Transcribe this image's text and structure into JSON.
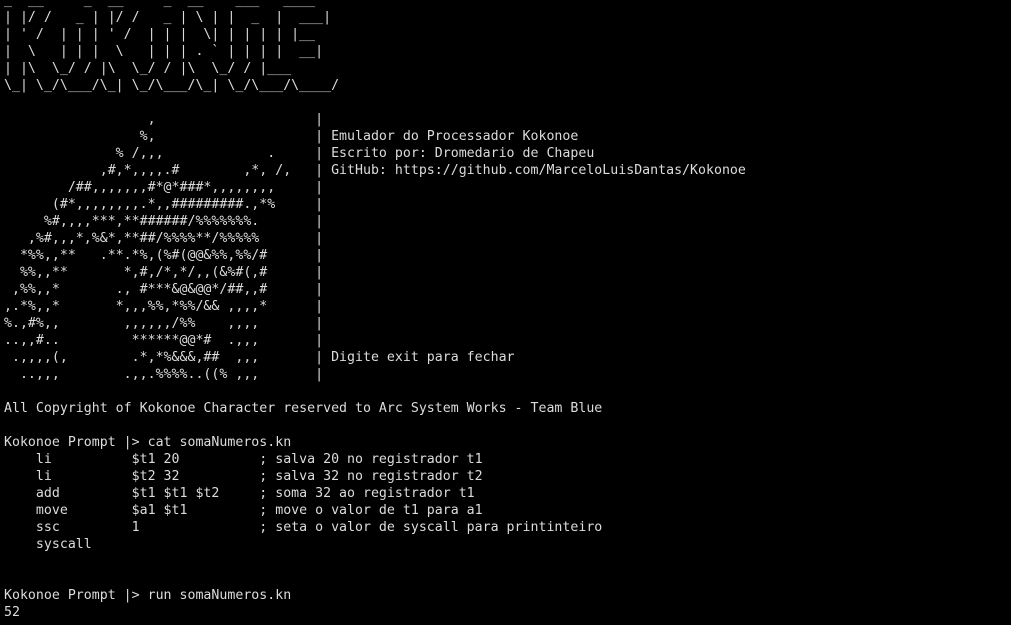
{
  "terminal": {
    "lines": [
      "_  __     _  __     _  __    ___   ____  ",
      "| |/ /   _ | |/ /   _ | \\ | |  _  |  ___|",
      "| ' /  | | | ' /  | | |  \\| | | | | |__  ",
      "|  \\   | | |  \\   | | | . ` | | | |  __| ",
      "| |\\  \\_/ / |\\  \\_/ / |\\  \\_/ / |___ ",
      "\\_| \\_/\\___/\\_| \\_/\\___/\\_| \\_/\\___/\\____/ ",
      "",
      "                  ,                    |",
      "                 %,                    | Emulador do Processador Kokonoe",
      "              % /,,,             .     | Escrito por: Dromedario de Chapeu",
      "            ,#,*,,,,.#        ,*, /,   | GitHub: https://github.com/MarceloLuisDantas/Kokonoe",
      "        /##,,,,,,,#*@*###*,,,,,,,,     |",
      "      (#*,,,,,,,,.*,,#########.,*%     |",
      "     %#,,,,***,**######/%%%%%%%.       |",
      "   ,%#,,,*,%&*,**##/%%%%**/%%%%%       |",
      "  *%%,,**   .**.*%,(%#(@@&%%,%%/#      |",
      "  %%,,**       *,#,/*,*/,,(&%#(,#      |",
      " ,%%,,*       ., #***&@&@@*/##,,#      |",
      ",.*%,,*       *,,,%%,*%%/&& ,,,,*      |",
      "%.,#%,,        ,,,,,,/%%    ,,,,       |",
      "..,,#..         ******@@*#  .,,,       |",
      " .,,,,(,        .*,*%&&&,##  ,,,       | Digite exit para fechar",
      "  ..,,,        .,,.%%%%..((% ,,,       |",
      "",
      "All Copyright of Kokonoe Character reserved to Arc System Works - Team Blue",
      "",
      "Kokonoe Prompt |> cat somaNumeros.kn",
      "    li          $t1 20          ; salva 20 no registrador t1",
      "    li          $t2 32          ; salva 32 no registrador t2",
      "    add         $t1 $t1 $t2     ; soma 32 ao registrador t1",
      "    move        $a1 $t1         ; move o valor de t1 para a1",
      "    ssc         1               ; seta o valor de syscall para printinteiro",
      "    syscall",
      "",
      "",
      "Kokonoe Prompt |> run somaNumeros.kn",
      "52"
    ]
  }
}
